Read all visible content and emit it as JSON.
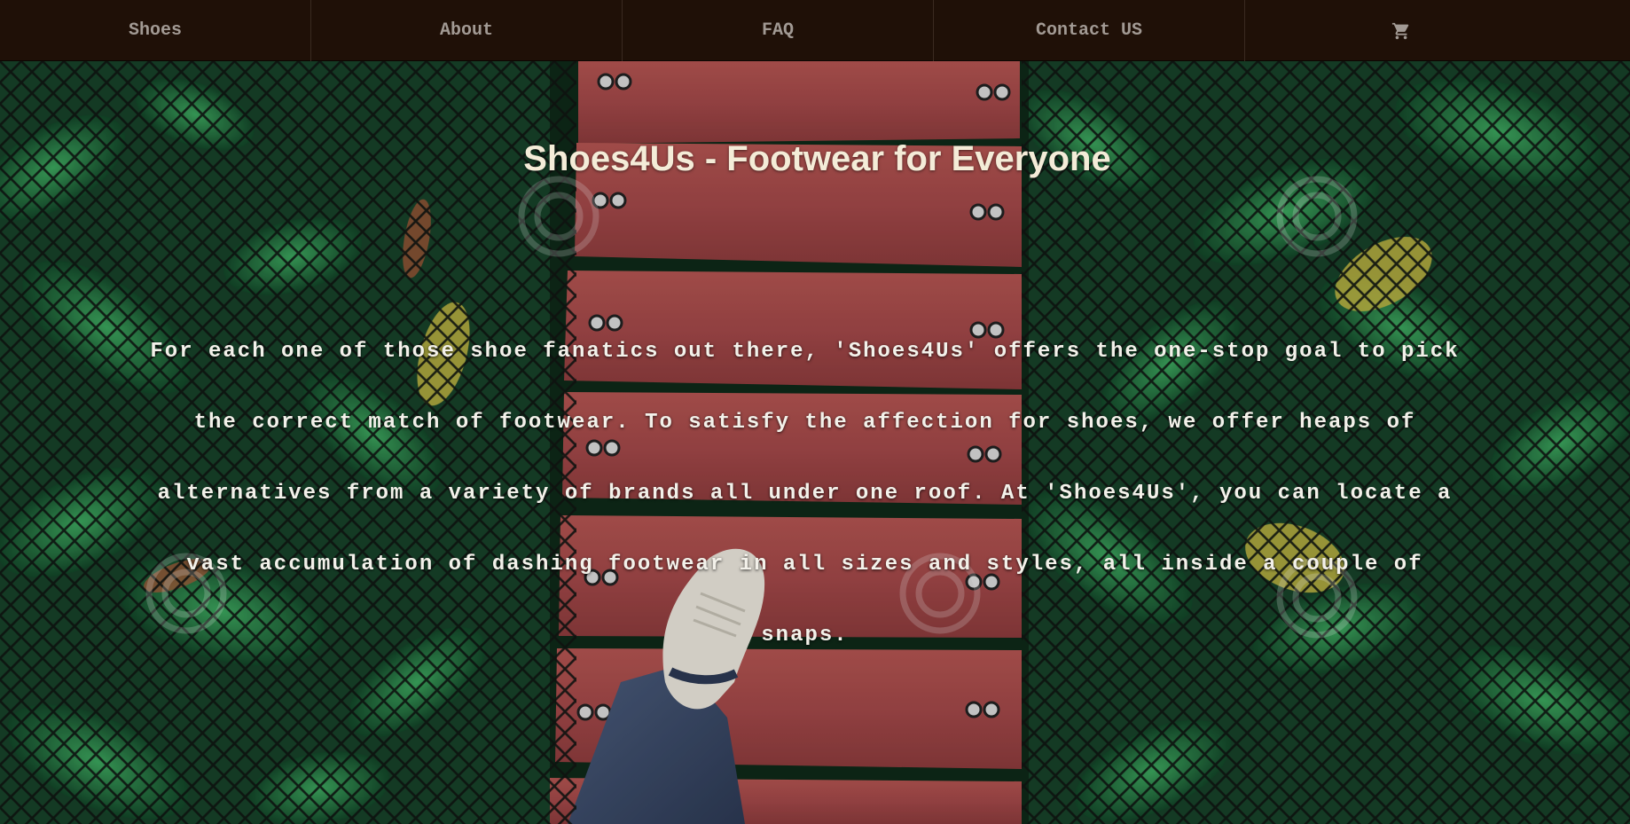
{
  "nav": {
    "items": [
      {
        "label": "Shoes"
      },
      {
        "label": "About"
      },
      {
        "label": "FAQ"
      },
      {
        "label": "Contact US"
      }
    ],
    "cart_icon": "shopping-cart-icon"
  },
  "hero": {
    "title": "Shoes4Us - Footwear for Everyone",
    "description": "For each one of those shoe fanatics out there, 'Shoes4Us' offers the one-stop goal to pick the correct match of footwear. To satisfy the affection for shoes, we offer heaps of alternatives from a variety of brands all under one roof. At 'Shoes4Us', you can locate a vast accumulation of dashing footwear in all sizes and styles, all inside a couple of snaps.",
    "background_image": "rope-bridge-sneaker-photo"
  },
  "colors": {
    "navbar": "#1f1007",
    "nav_text": "#a29a94",
    "title_text": "#f4ecd8",
    "body_text": "#f3f1ea",
    "planks": "#a44a48",
    "foliage": "#1e5a36"
  }
}
